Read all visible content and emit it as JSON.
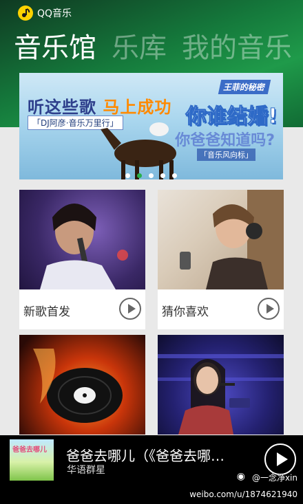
{
  "app": {
    "title": "QQ音乐"
  },
  "tabs": [
    "音乐馆",
    "乐库",
    "我的音乐"
  ],
  "banner": {
    "headline_part1": "听这些歌",
    "headline_part2": "马上成功",
    "subline": "「DJ阿彦·音乐万里行」",
    "badge": "王菲的秘密",
    "right_big": "你谁结婚!",
    "right_question": "你爸爸知道吗?",
    "right_small": "「音乐风向标」",
    "dots_total": 5,
    "dots_active": 2
  },
  "cards": [
    {
      "label": "新歌首发",
      "image": "female-singer-microphone"
    },
    {
      "label": "猜你喜欢",
      "image": "man-headphones"
    },
    {
      "label": "",
      "image": "flaming-vinyl-record"
    },
    {
      "label": "",
      "image": "girl-singing-stage"
    }
  ],
  "player": {
    "song": "爸爸去哪儿（《爸爸去哪…",
    "artist": "华语群星",
    "album_text": "爸爸去哪儿"
  },
  "watermark": {
    "handle": "@一念净xin",
    "url": "weibo.com/u/1874621940"
  },
  "colors": {
    "accent": "#28b04a",
    "header_green": "#157a3c"
  }
}
